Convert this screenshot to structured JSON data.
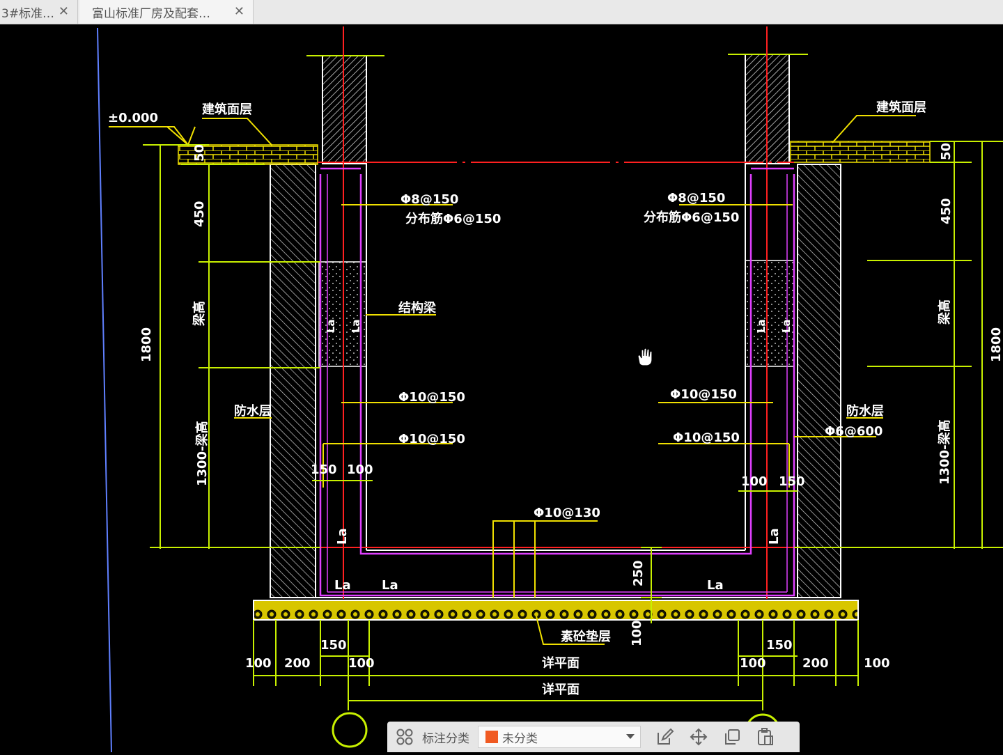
{
  "tabs": [
    {
      "label": "3#标准…",
      "close": "✕"
    },
    {
      "label": "富山标准厂房及配套…",
      "close": "✕"
    }
  ],
  "drawing": {
    "labels": {
      "elev": "±0.000",
      "arch_layer_l": "建筑面层",
      "arch_layer_r": "建筑面层",
      "rebar_top_l": "Φ8@150",
      "dist_l": "分布筋Φ6@150",
      "rebar_top_r": "Φ8@150",
      "dist_r": "分布筋Φ6@150",
      "struct_beam": "结构梁",
      "phi10_1_l": "Φ10@150",
      "phi10_2_l": "Φ10@150",
      "phi10_1_r": "Φ10@150",
      "phi10_2_r": "Φ10@150",
      "waterproof_l": "防水层",
      "waterproof_r": "防水层",
      "phi6_600": "Φ6@600",
      "bottom_rebar": "Φ10@130",
      "cushion": "素砼垫层",
      "plan_1": "详平面",
      "plan_2": "详平面",
      "la": "La",
      "beam_height": "梁高",
      "h1300_l": "1300-梁高",
      "h1300_r": "1300-梁高"
    },
    "dims": {
      "d50": "50",
      "d450": "450",
      "d1800": "1800",
      "d150": "150",
      "d100": "100",
      "d200": "200",
      "d250": "250"
    },
    "colors": {
      "dim": "#c8f000",
      "yellow": "#f0e000",
      "magenta": "#e040ff",
      "red": "#ff2020",
      "white": "#ffffff",
      "hatch": "#d8d8d8"
    }
  },
  "toolbar": {
    "grid_icon": "grid-icon",
    "annotation_label": "标注分类",
    "category_value": "未分类",
    "category_color": "#f05a22",
    "edit_icon": "edit-icon",
    "move_icon": "move-icon",
    "copy_icon": "copy-icon",
    "paste_icon": "paste-icon"
  }
}
